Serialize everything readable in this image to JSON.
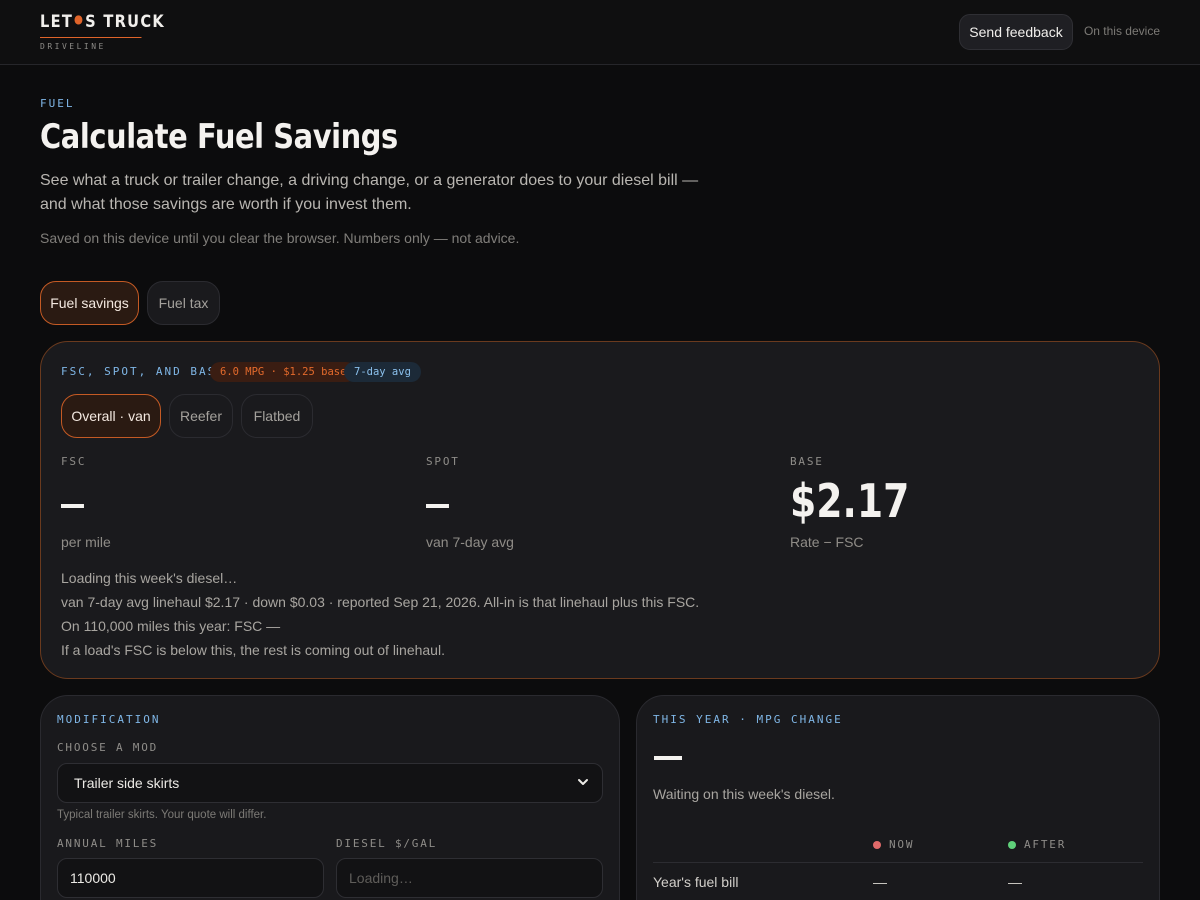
{
  "header": {
    "brand_pre": "LET",
    "brand_post": "S TRUCK",
    "brand_sub": "DRIVELINE",
    "feedback_label": "Send feedback",
    "device_label": "On this device"
  },
  "hero": {
    "eyebrow": "FUEL",
    "title": "Calculate Fuel Savings",
    "description": "See what a truck or trailer change, a driving change, or a generator does to your diesel bill — and what those savings are worth if you invest them.",
    "note": "Saved on this device until you clear the browser. Numbers only — not advice."
  },
  "tabs": [
    {
      "label": "Fuel savings",
      "active": true
    },
    {
      "label": "Fuel tax",
      "active": false
    }
  ],
  "fsc": {
    "eyebrow": "FSC, SPOT, AND BASE",
    "badge_orange": "6.0 MPG · $1.25 base",
    "badge_blue": "7-day avg",
    "segments": [
      {
        "label": "Overall · van",
        "active": true
      },
      {
        "label": "Reefer",
        "active": false
      },
      {
        "label": "Flatbed",
        "active": false
      }
    ],
    "metrics": {
      "fsc": {
        "label": "FSC",
        "value": "—",
        "sub": "per mile"
      },
      "spot": {
        "label": "SPOT",
        "value": "—",
        "sub": "van 7-day avg"
      },
      "base": {
        "label": "BASE",
        "value": "$2.17",
        "sub": "Rate − FSC"
      }
    },
    "notes": [
      "Loading this week's diesel…",
      "van 7-day avg linehaul $2.17 · down $0.03 · reported Sep 21, 2026. All-in is that linehaul plus this FSC.",
      "On 110,000 miles this year: FSC —",
      "If a load's FSC is below this, the rest is coming out of linehaul."
    ]
  },
  "modification": {
    "eyebrow": "MODIFICATION",
    "choose_label": "CHOOSE A MOD",
    "selected_mod": "Trailer side skirts",
    "helper": "Typical trailer skirts. Your quote will differ.",
    "miles_label": "ANNUAL MILES",
    "miles_value": "110000",
    "diesel_label": "DIESEL $/GAL",
    "diesel_placeholder": "Loading…"
  },
  "this_year": {
    "eyebrow": "THIS YEAR · MPG CHANGE",
    "value": "—",
    "waiting": "Waiting on this week's diesel.",
    "col_now": "NOW",
    "col_after": "AFTER",
    "row_label": "Year's fuel bill",
    "row_now": "—",
    "row_after": "—"
  },
  "colors": {
    "accent": "#e0642a",
    "eyebrow_blue": "#7fb6e6",
    "now_dot": "#e06a6a",
    "after_dot": "#5fd07a"
  },
  "icons": {
    "select_chevron": "chevron-down-icon"
  }
}
